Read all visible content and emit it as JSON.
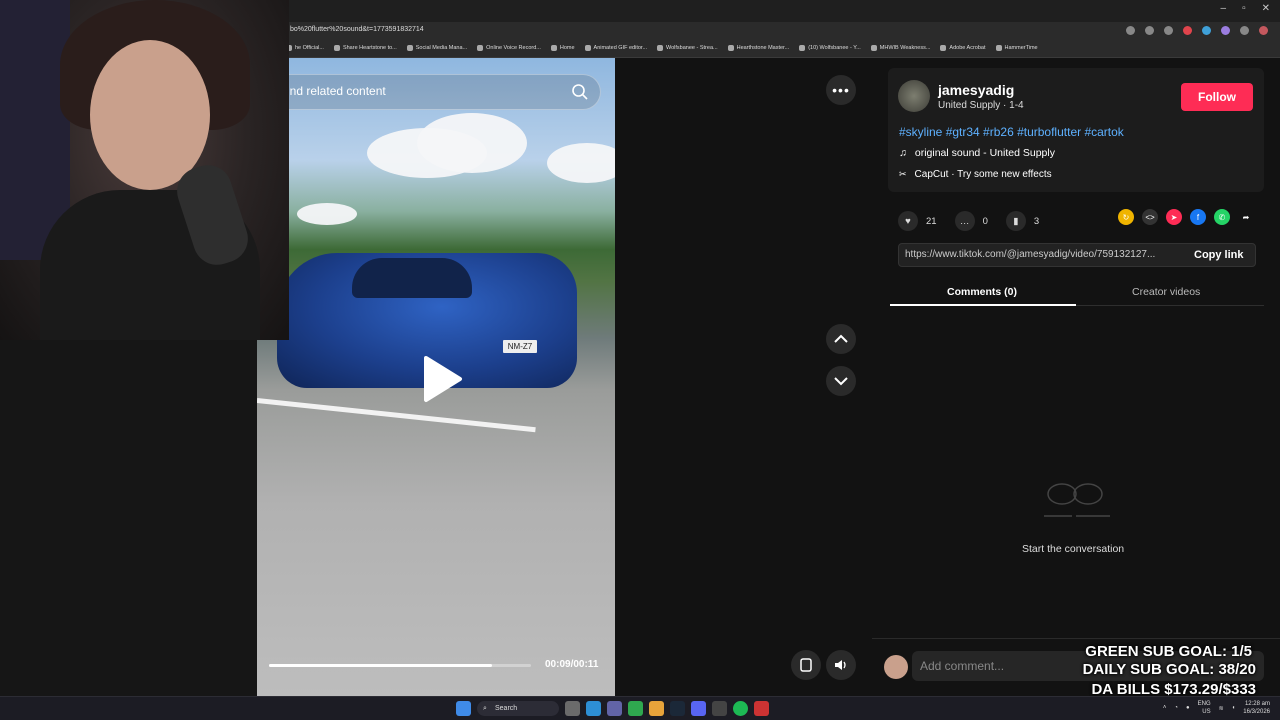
{
  "browser": {
    "url": "bo%20flutter%20sound&t=1773591832714",
    "bookmarks": [
      "he Official...",
      "Share Heartstone to...",
      "Social Media Mana...",
      "Online Voice Record...",
      "Home",
      "Animated GIF editor...",
      "Wolfsbanee - Strea...",
      "Hearthstone Master...",
      "(10) Wolfsbanee - Y...",
      "MHWIB Weakness...",
      "Adobe Acrobat",
      "HammerTime"
    ]
  },
  "video": {
    "search_placeholder": "ind related content",
    "plate": "NM-Z7",
    "time": "00:09/00:11",
    "progress": 0.85
  },
  "post": {
    "username": "jamesyadig",
    "subline": "United Supply · 1-4",
    "follow_label": "Follow",
    "hashtags": "#skyline #gtr34 #rb26 #turboflutter #cartok",
    "sound": "original sound - United Supply",
    "capcut": "CapCut · Try some new effects",
    "likes": "21",
    "comments": "0",
    "bookmarks": "3",
    "link": "https://www.tiktok.com/@jamesyadig/video/759132127...",
    "copy_label": "Copy link"
  },
  "tabs": {
    "comments": "Comments (0)",
    "creator_videos": "Creator videos"
  },
  "empty_state": "Start the conversation",
  "comment_placeholder": "Add comment...",
  "overlay": {
    "line1": "GREEN SUB GOAL: 1/5",
    "line2": "DAILY SUB GOAL: 38/20",
    "line3": "DA BILLS $173.29/$333"
  },
  "taskbar": {
    "search": "Search",
    "lang1": "ENG",
    "lang2": "US",
    "time": "12:28 am",
    "date": "16/3/2026"
  },
  "colors": {
    "accent": "#fe2c55",
    "hashtag": "#5eb1ff"
  }
}
